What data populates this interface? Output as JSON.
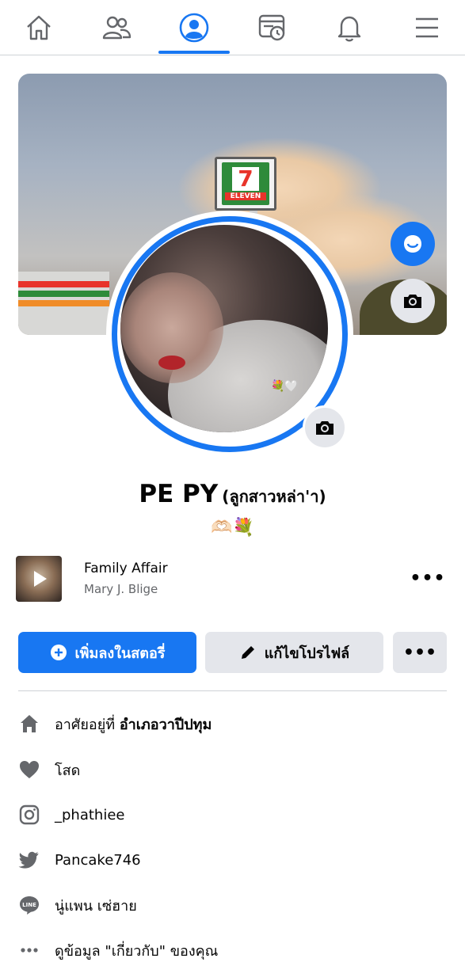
{
  "nav": {
    "tabs": [
      {
        "name": "home-tab",
        "icon": "home-icon",
        "active": false
      },
      {
        "name": "friends-tab",
        "icon": "friends-icon",
        "active": false
      },
      {
        "name": "profile-tab",
        "icon": "profile-icon",
        "active": true
      },
      {
        "name": "watch-tab",
        "icon": "memories-icon",
        "active": false
      },
      {
        "name": "notifications-tab",
        "icon": "bell-icon",
        "active": false
      },
      {
        "name": "menu-tab",
        "icon": "hamburger-icon",
        "active": false
      }
    ],
    "accent": "#1877f2"
  },
  "cover": {
    "sign_number": "7",
    "sign_text": "ELEVEN",
    "messenger_button_icon": "messenger-icon",
    "camera_button_icon": "camera-icon"
  },
  "profile": {
    "name": "PE PY",
    "alternate_name": "(ลูกสาวหล่า'า)",
    "bio": "🫶🏻💐",
    "avatar_emoji": "💐🤍"
  },
  "music": {
    "title": "Family Affair",
    "artist": "Mary J. Blige",
    "more_label": "•••"
  },
  "actions": {
    "add_story_label": "เพิ่มลงในสตอรี่",
    "edit_profile_label": "แก้ไขโปรไฟล์",
    "more_label": "•••"
  },
  "intro": {
    "lives_prefix": "อาศัยอยู่ที่ ",
    "lives_place": "อำเภอวาปีปทุม",
    "relationship": "โสด",
    "instagram": "_phathiee",
    "twitter": "Pancake746",
    "line": "นู่แพน เซ่ฮาย",
    "about_more": "ดูข้อมูล \"เกี่ยวกับ\" ของคุณ"
  },
  "colors": {
    "primary": "#1877f2",
    "secondary_bg": "#e4e6eb",
    "icon_gray": "#65676b"
  }
}
